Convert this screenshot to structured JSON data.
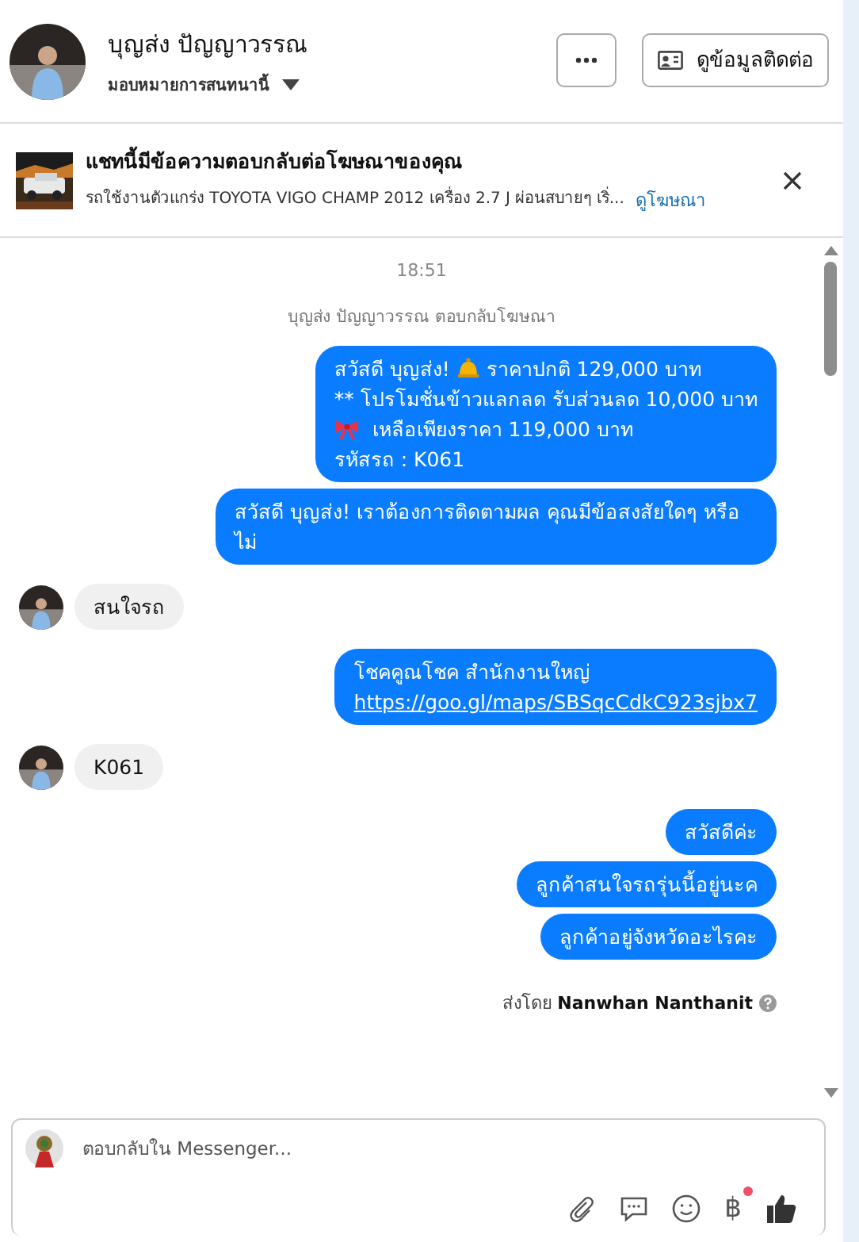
{
  "header": {
    "name": "บุญส่ง ปัญญาวรรณ",
    "subtitle": "มอบหมายการสนทนานี้",
    "contact_button": "ดูข้อมูลติดต่อ"
  },
  "ad_banner": {
    "title": "แชทนี้มีข้อความตอบกลับต่อโฆษณาของคุณ",
    "description": "รถใช้งานตัวแกร่ง TOYOTA VIGO CHAMP 2012 เครื่อง 2.7 J ผ่อนสบายๆ เริ่...",
    "link": "ดูโฆษณา"
  },
  "messages": [
    {
      "kind": "time",
      "text": "18:51"
    },
    {
      "kind": "system",
      "text": "บุญส่ง ปัญญาวรรณ ตอบกลับโฆษณา"
    },
    {
      "kind": "outgoing",
      "lines": [
        {
          "kind": "bell",
          "before": "สวัสดี บุญส่ง!",
          "after": "ราคาปกติ 129,000 บาท"
        },
        {
          "kind": "plain",
          "text": "** โปรโมชั่นข้าวแลกลด รับส่วนลด 10,000 บาท"
        },
        {
          "kind": "ribbon",
          "after": "เหลือเพียงราคา 119,000 บาท"
        },
        {
          "kind": "plain",
          "text": " รหัสรถ : K061"
        }
      ]
    },
    {
      "kind": "outgoing",
      "text": "สวัสดี บุญส่ง! เราต้องการติดตามผล คุณมีข้อสงสัยใดๆ หรือไม่"
    },
    {
      "kind": "incoming",
      "text": "สนใจรถ"
    },
    {
      "kind": "outgoing",
      "text": "โชคคูณโชค สำนักงานใหญ่",
      "link": "https://goo.gl/maps/SBSqcCdkC923sjbx7"
    },
    {
      "kind": "incoming",
      "text": "K061"
    },
    {
      "kind": "outgoing",
      "text": "สวัสดีค่ะ"
    },
    {
      "kind": "outgoing",
      "text": "ลูกค้าสนใจรถรุ่นนี้อยู่นะค"
    },
    {
      "kind": "outgoing",
      "text": "ลูกค้าอยู่จังหวัดอะไรคะ"
    },
    {
      "kind": "sent_by",
      "label": "ส่งโดย",
      "name": "Nanwhan Nanthanit"
    }
  ],
  "composer": {
    "placeholder": "ตอบกลับใน Messenger...",
    "currency_symbol": "฿",
    "currency_notification": true
  }
}
